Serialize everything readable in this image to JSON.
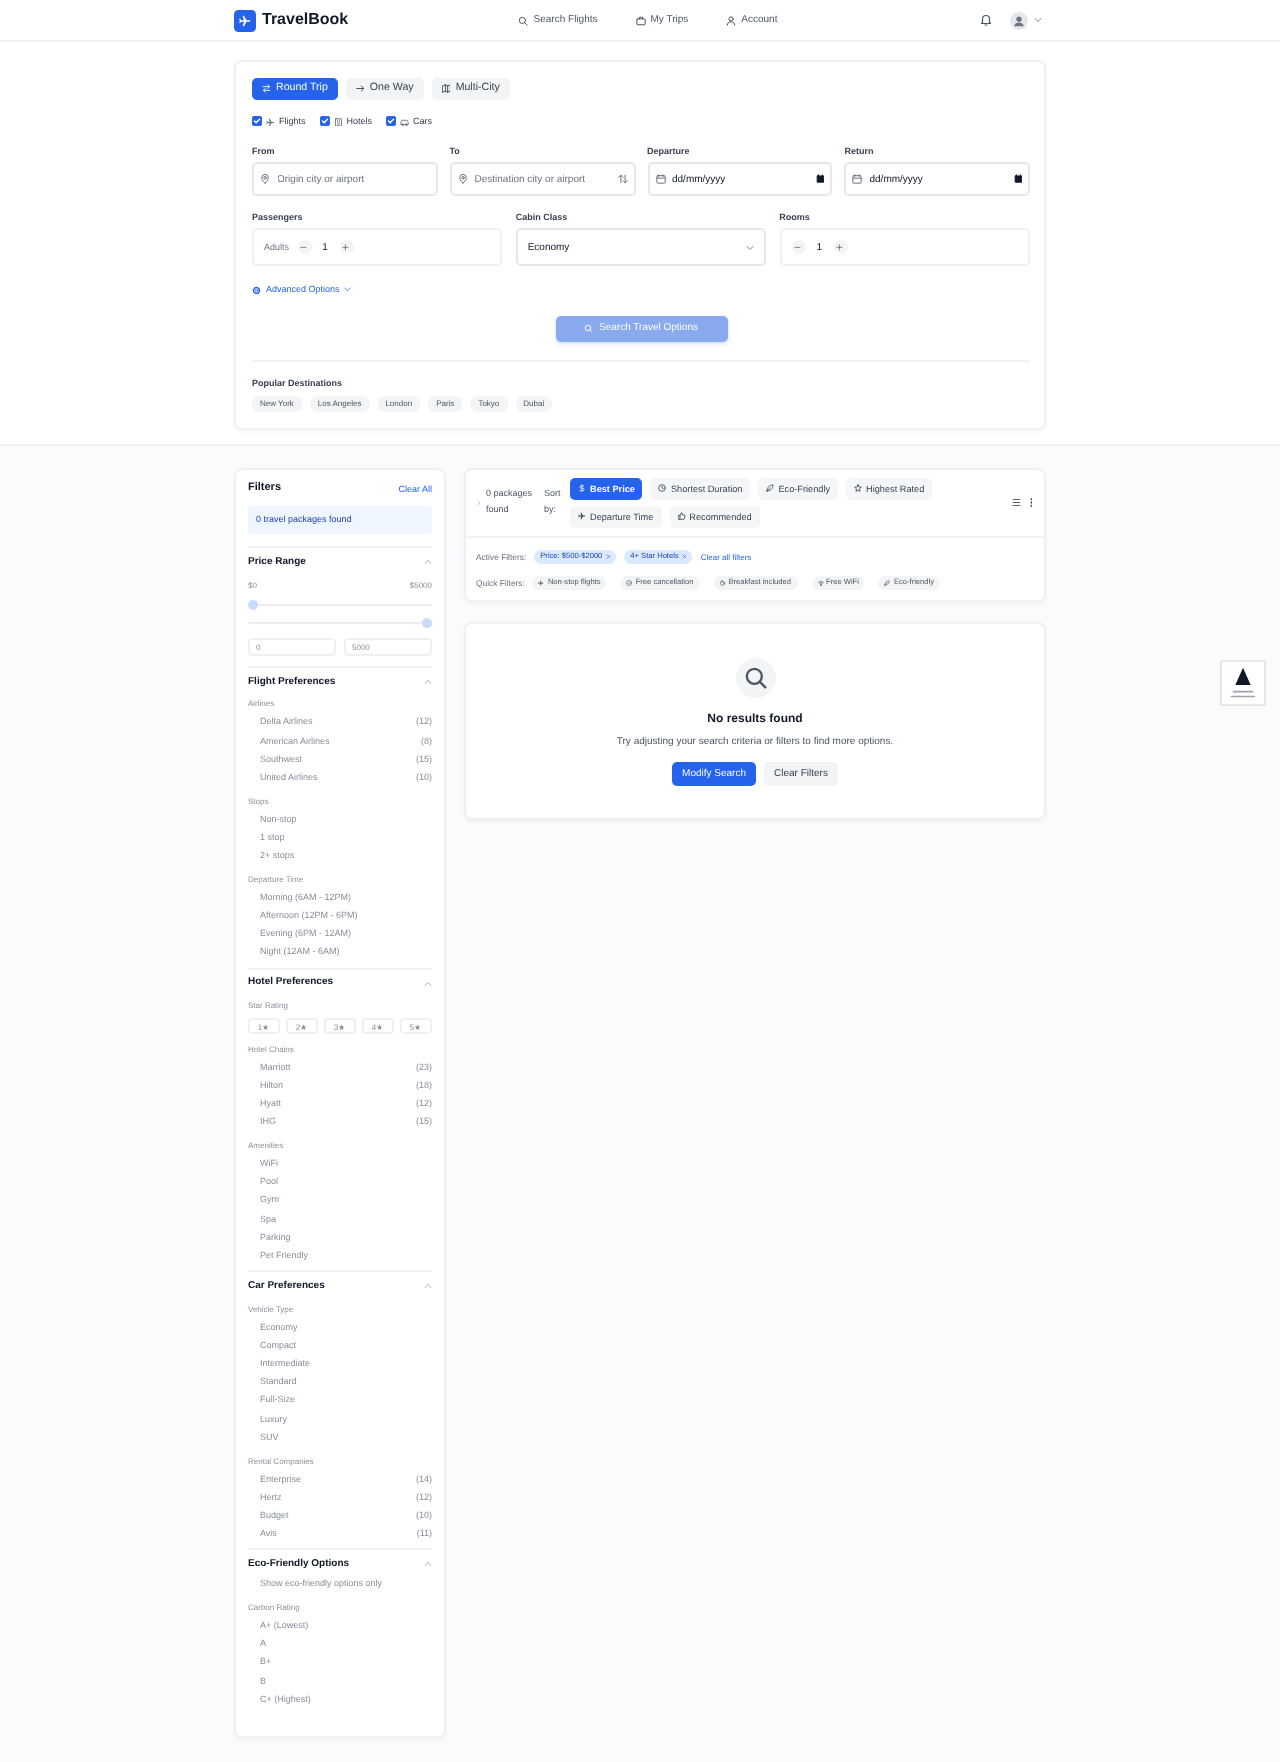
{
  "navbar": {
    "brand": "TravelBook",
    "links": [
      "Search Flights",
      "My Trips",
      "Account"
    ]
  },
  "search": {
    "trip_types": [
      {
        "label": "Round Trip",
        "selected": true
      },
      {
        "label": "One Way",
        "selected": false
      },
      {
        "label": "Multi-City",
        "selected": false
      }
    ],
    "services": [
      {
        "label": "Flights",
        "checked": true
      },
      {
        "label": "Hotels",
        "checked": true
      },
      {
        "label": "Cars",
        "checked": true
      }
    ],
    "fields": [
      {
        "kind": "location",
        "label": "From",
        "placeholder": "Origin city or airport"
      },
      {
        "kind": "location_swap",
        "label": "To",
        "placeholder": "Destination city or airport"
      },
      {
        "kind": "date",
        "label": "Departure",
        "placeholder": "dd/mm/yyyy"
      },
      {
        "kind": "date",
        "label": "Return",
        "placeholder": "dd/mm/yyyy"
      }
    ],
    "controls": [
      {
        "kind": "stepper",
        "label": "Passengers",
        "unit": "Adults",
        "value": "1"
      },
      {
        "kind": "select",
        "label": "Cabin Class",
        "value": "Economy"
      },
      {
        "kind": "stepper",
        "label": "Rooms",
        "value": "1"
      }
    ],
    "advanced": "Advanced Options",
    "submit": {
      "label": "Search Travel Options",
      "disabled": true
    },
    "popular": {
      "title": "Popular Destinations",
      "items": [
        "New York",
        "Los Angeles",
        "London",
        "Paris",
        "Tokyo",
        "Dubai"
      ]
    }
  },
  "filters": {
    "title": "Filters",
    "clear": "Clear All",
    "summary": "0 travel packages found",
    "sections": [
      {
        "kind": "price",
        "title": "Price Range",
        "expanded": true,
        "range_labels": [
          "$0",
          "$5000"
        ],
        "sliders": [
          {
            "level": 0
          },
          {
            "level": 1
          }
        ],
        "inputs": [
          "0",
          "5000"
        ]
      },
      {
        "kind": "groups",
        "title": "Flight Preferences",
        "expanded": true,
        "groups": [
          {
            "kind": "list",
            "label": "Airlines",
            "options": [
              {
                "label": "Delta Airlines",
                "count": "(12)"
              },
              {
                "label": "American Airlines",
                "count": "(8)"
              },
              {
                "label": "Southwest",
                "count": "(15)"
              },
              {
                "label": "United Airlines",
                "count": "(10)"
              }
            ]
          },
          {
            "kind": "list",
            "label": "Stops",
            "options": [
              {
                "label": "Non-stop"
              },
              {
                "label": "1 stop"
              },
              {
                "label": "2+ stops"
              }
            ]
          },
          {
            "kind": "list",
            "label": "Departure Time",
            "options": [
              {
                "label": "Morning (6AM - 12PM)"
              },
              {
                "label": "Afternoon (12PM - 6PM)"
              },
              {
                "label": "Evening (6PM - 12AM)"
              },
              {
                "label": "Night (12AM - 6AM)"
              }
            ]
          }
        ]
      },
      {
        "kind": "groups",
        "title": "Hotel Preferences",
        "expanded": true,
        "groups": [
          {
            "kind": "stars",
            "label": "Star Rating",
            "options": [
              "1★",
              "2★",
              "3★",
              "4★",
              "5★"
            ]
          },
          {
            "kind": "list",
            "label": "Hotel Chains",
            "options": [
              {
                "label": "Marriott",
                "count": "(23)"
              },
              {
                "label": "Hilton",
                "count": "(18)"
              },
              {
                "label": "Hyatt",
                "count": "(12)"
              },
              {
                "label": "IHG",
                "count": "(15)"
              }
            ]
          },
          {
            "kind": "list",
            "label": "Amenities",
            "options": [
              {
                "label": "WiFi"
              },
              {
                "label": "Pool"
              },
              {
                "label": "Gym"
              },
              {
                "label": "Spa"
              },
              {
                "label": "Parking"
              },
              {
                "label": "Pet Friendly"
              }
            ]
          }
        ]
      },
      {
        "kind": "groups",
        "title": "Car Preferences",
        "expanded": true,
        "groups": [
          {
            "kind": "list",
            "label": "Vehicle Type",
            "options": [
              {
                "label": "Economy"
              },
              {
                "label": "Compact"
              },
              {
                "label": "Intermediate"
              },
              {
                "label": "Standard"
              },
              {
                "label": "Full-Size"
              },
              {
                "label": "Luxury"
              },
              {
                "label": "SUV"
              }
            ]
          },
          {
            "kind": "list",
            "label": "Rental Companies",
            "options": [
              {
                "label": "Enterprise",
                "count": "(14)"
              },
              {
                "label": "Hertz",
                "count": "(12)"
              },
              {
                "label": "Budget",
                "count": "(10)"
              },
              {
                "label": "Avis",
                "count": "(11)"
              }
            ]
          }
        ]
      },
      {
        "kind": "groups",
        "title": "Eco-Friendly Options",
        "expanded": true,
        "groups": [
          {
            "kind": "list",
            "options": [
              {
                "label": "Show eco-friendly options only"
              }
            ]
          },
          {
            "kind": "list",
            "label": "Carbon Rating",
            "options": [
              {
                "label": "A+ (Lowest)"
              },
              {
                "label": "A"
              },
              {
                "label": "B+"
              },
              {
                "label": "B"
              },
              {
                "label": "C+ (Highest)"
              }
            ]
          }
        ]
      }
    ]
  },
  "results": {
    "count": "0 packages found",
    "sort_label": "Sort by:",
    "sort_options": [
      {
        "label": "Best Price",
        "selected": true
      },
      {
        "label": "Shortest Duration",
        "selected": false
      },
      {
        "label": "Eco-Friendly",
        "selected": false
      },
      {
        "label": "Highest Rated",
        "selected": false
      },
      {
        "label": "Departure Time",
        "selected": false
      },
      {
        "label": "Recommended",
        "selected": false
      }
    ],
    "active_filters_label": "Active Filters:",
    "active_filters": [
      "Price: $500-$2000",
      "4+ Star Hotels"
    ],
    "clear_filters": "Clear all filters",
    "quick_filters_label": "Quick Filters:",
    "quick_filters": [
      "Non-stop flights",
      "Free cancellation",
      "Breakfast included",
      "Free WiFi",
      "Eco-friendly"
    ]
  },
  "empty_state": {
    "title": "No results found",
    "message": "Try adjusting your search criteria or filters to find more options.",
    "buttons": [
      {
        "kind": "primary",
        "label": "Modify Search"
      },
      {
        "kind": "secondary",
        "label": "Clear Filters"
      }
    ]
  }
}
